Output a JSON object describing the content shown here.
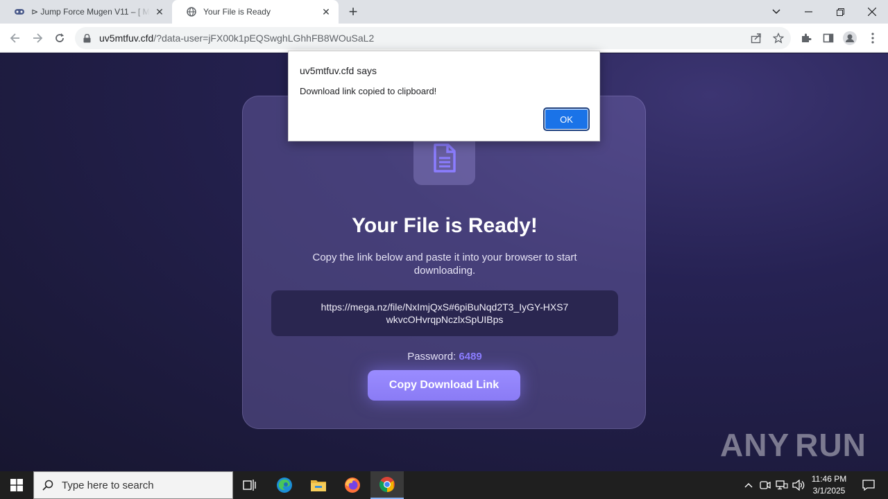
{
  "browser": {
    "tabs": [
      {
        "title": "⊳ Jump Force Mugen V11 – [ M",
        "favicon": "gamepad-icon"
      },
      {
        "title": "Your File is Ready",
        "favicon": "globe-icon"
      }
    ],
    "url_host": "uv5mtfuv.cfd",
    "url_rest": "/?data-user=jFX00k1pEQSwghLGhhFB8WOuSaL2"
  },
  "page": {
    "headline": "Your File is Ready!",
    "subtext": "Copy the link below and paste it into your browser to start downloading.",
    "download_link": "https://mega.nz/file/NxImjQxS#6piBuNqd2T3_IyGY-HXS7wkvcOHvrqpNczlxSpUIBps",
    "password_label": "Password:",
    "password_value": "6489",
    "copy_button": "Copy Download Link",
    "colors": {
      "accent": "#8b7dff",
      "card": "#5a5290",
      "background": "#1b1838"
    }
  },
  "dialog": {
    "origin": "uv5mtfuv.cfd says",
    "message": "Download link copied to clipboard!",
    "ok_label": "OK"
  },
  "watermark": {
    "left": "ANY",
    "right": "RUN"
  },
  "taskbar": {
    "search_placeholder": "Type here to search",
    "time": "11:46 PM",
    "date": "3/1/2025"
  }
}
